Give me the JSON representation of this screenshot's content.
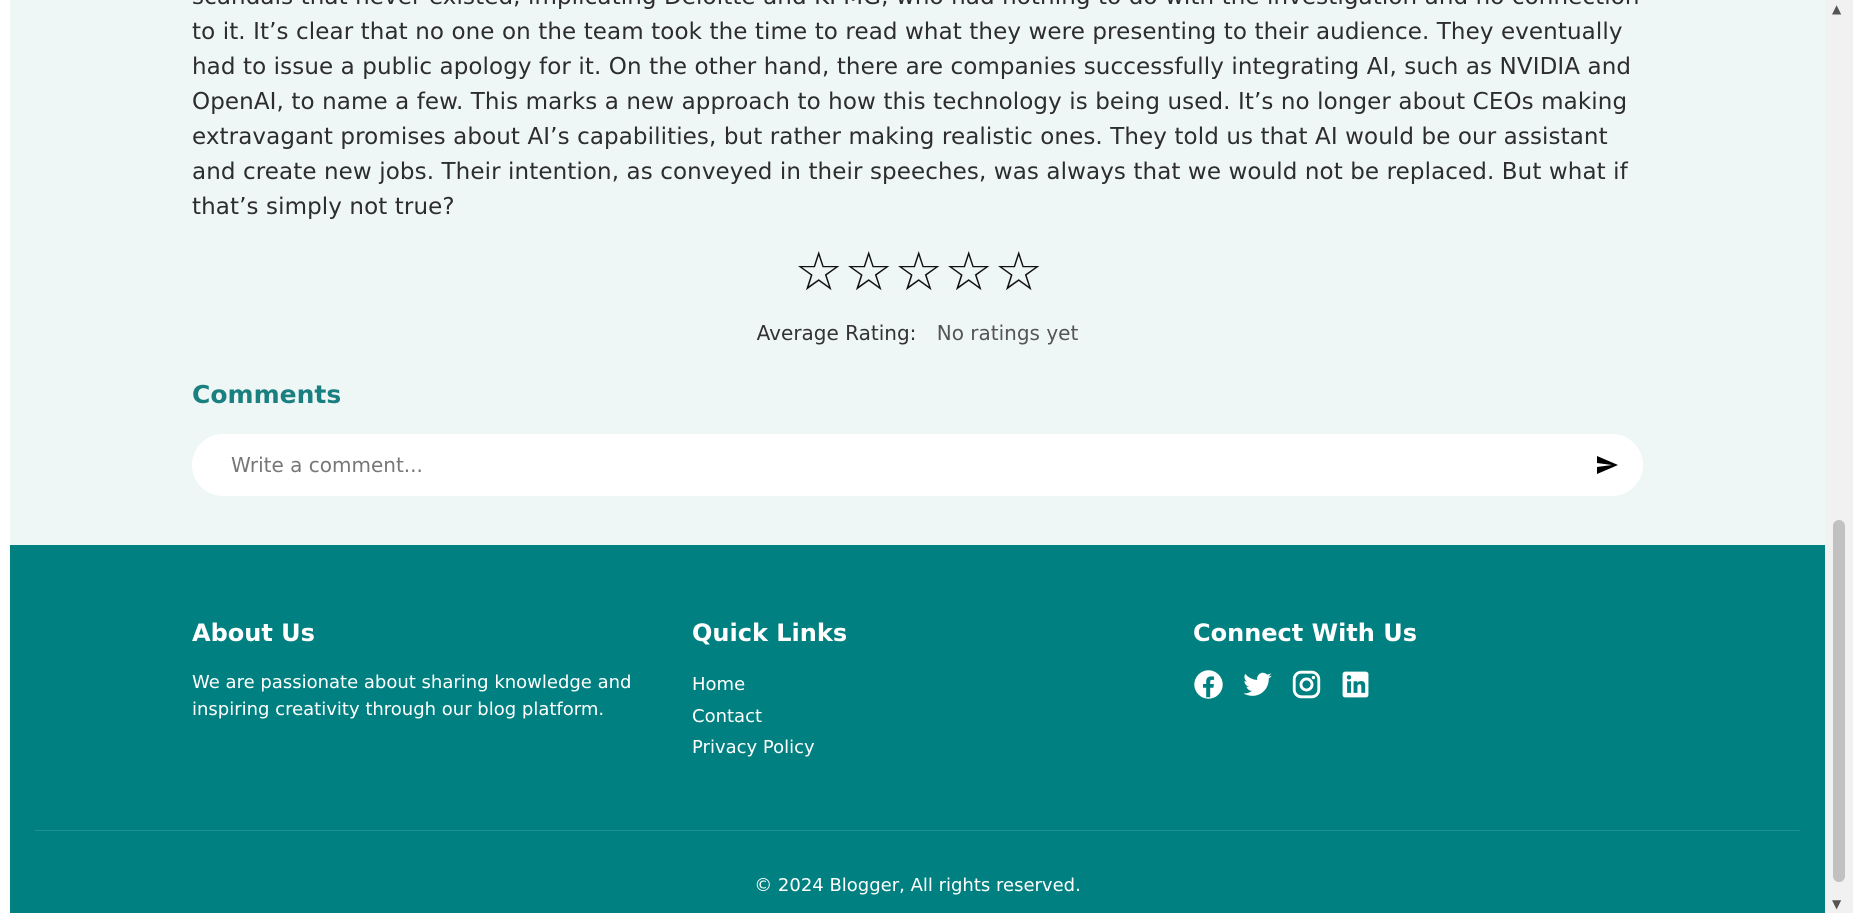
{
  "article": {
    "text": "scandals that never existed, implicating Deloitte and KPMG, who had nothing to do with the investigation and no connection to it. It’s clear that no one on the team took the time to read what they were presenting to their audience. They eventually had to issue a public apology for it. On the other hand, there are companies successfully integrating AI, such as NVIDIA and OpenAI, to name a few. This marks a new approach to how this technology is being used. It’s no longer about CEOs making extravagant promises about AI’s capabilities, but rather making realistic ones. They told us that AI would be our assistant and create new jobs. Their intention, as conveyed in their speeches, was always that we would not be replaced. But what if that’s simply not true?"
  },
  "rating": {
    "stars": [
      "☆",
      "☆",
      "☆",
      "☆",
      "☆"
    ],
    "stars_filled": 0,
    "stars_max": 5,
    "average_label": "Average Rating:",
    "average_value": "No ratings yet"
  },
  "comments": {
    "title": "Comments",
    "placeholder": "Write a comment...",
    "send_icon": "send-icon"
  },
  "footer": {
    "about": {
      "title": "About Us",
      "text": "We are passionate about sharing knowledge and inspiring creativity through our blog platform."
    },
    "quick_links": {
      "title": "Quick Links",
      "links": [
        "Home",
        "Contact",
        "Privacy Policy"
      ]
    },
    "connect": {
      "title": "Connect With Us",
      "icons": [
        "facebook-icon",
        "twitter-icon",
        "instagram-icon",
        "linkedin-icon"
      ]
    },
    "copyright": "© 2024 Blogger, All rights reserved."
  },
  "colors": {
    "footer_bg": "#008080",
    "page_bg": "#eff7f6",
    "accent": "#1a7f7f"
  }
}
